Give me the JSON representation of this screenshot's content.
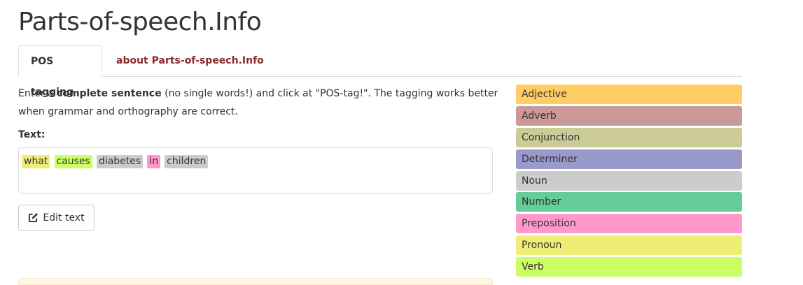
{
  "header": {
    "title": "Parts-of-speech.Info"
  },
  "tabs": [
    {
      "label": "POS tagging"
    },
    {
      "label": "about Parts-of-speech.Info"
    }
  ],
  "intro": {
    "part1": "Enter a ",
    "bold": "complete sentence",
    "part2": " (no single words!) and click at \"POS-tag!\". The tagging works better when grammar and orthography are correct."
  },
  "text_label": "Text:",
  "words": [
    {
      "text": "what",
      "pos": "Pronoun",
      "color": "#eeee77"
    },
    {
      "text": "causes",
      "pos": "Verb",
      "color": "#ccff66"
    },
    {
      "text": "diabetes",
      "pos": "Noun",
      "color": "#cccccc"
    },
    {
      "text": "in",
      "pos": "Preposition",
      "color": "#ff99cc"
    },
    {
      "text": "children",
      "pos": "Noun",
      "color": "#cccccc"
    }
  ],
  "edit_button": {
    "label": "Edit text",
    "icon": "edit-icon"
  },
  "legend": [
    {
      "label": "Adjective",
      "color": "#ffcc66"
    },
    {
      "label": "Adverb",
      "color": "#cc9999"
    },
    {
      "label": "Conjunction",
      "color": "#cccc99"
    },
    {
      "label": "Determiner",
      "color": "#9999cc"
    },
    {
      "label": "Noun",
      "color": "#cccccc"
    },
    {
      "label": "Number",
      "color": "#66cc99"
    },
    {
      "label": "Preposition",
      "color": "#ff99cc"
    },
    {
      "label": "Pronoun",
      "color": "#eeee77"
    },
    {
      "label": "Verb",
      "color": "#ccff66"
    }
  ]
}
